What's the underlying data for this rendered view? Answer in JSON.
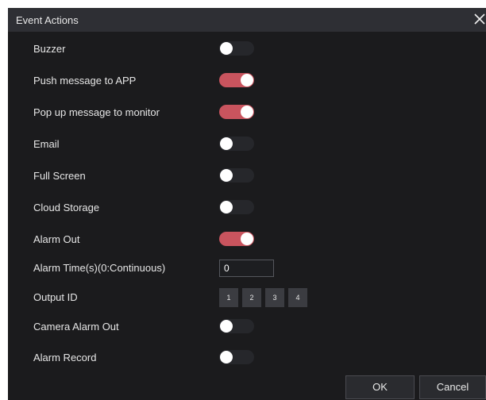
{
  "dialog": {
    "title": "Event Actions",
    "close_icon": "close-x-icon"
  },
  "settings": [
    {
      "label": "Buzzer",
      "enabled": false
    },
    {
      "label": "Push message to APP",
      "enabled": true
    },
    {
      "label": "Pop up message to monitor",
      "enabled": true
    },
    {
      "label": "Email",
      "enabled": false
    },
    {
      "label": "Full Screen",
      "enabled": false
    },
    {
      "label": "Cloud Storage",
      "enabled": false
    },
    {
      "label": "Alarm Out",
      "enabled": true
    }
  ],
  "alarm_time": {
    "label": "Alarm Time(s)(0:Continuous)",
    "value": "0"
  },
  "output_id": {
    "label": "Output ID",
    "options": [
      "1",
      "2",
      "3",
      "4"
    ]
  },
  "settings_after": [
    {
      "label": "Camera Alarm Out",
      "enabled": false
    },
    {
      "label": "Alarm Record",
      "enabled": false
    }
  ],
  "buttons": {
    "ok": "OK",
    "cancel": "Cancel"
  },
  "colors": {
    "toggle_on": "#c9545e",
    "toggle_off": "#26272b",
    "background": "#1b1b1d",
    "titlebar": "#2e2f34"
  }
}
